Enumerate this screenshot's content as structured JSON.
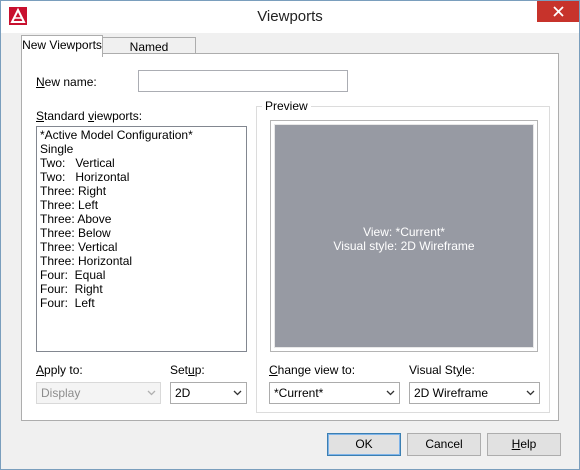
{
  "window": {
    "title": "Viewports"
  },
  "tabs": [
    {
      "label": "New Viewports",
      "active": true
    },
    {
      "label": "Named Viewports",
      "active": false
    }
  ],
  "new_name": {
    "label_first": "N",
    "label_rest": "ew name:",
    "value": ""
  },
  "standard_viewports": {
    "label_first": "S",
    "label_mid": "tandard ",
    "label_u": "v",
    "label_rest": "iewports:",
    "items": [
      "*Active Model Configuration*",
      "Single",
      "Two:   Vertical",
      "Two:   Horizontal",
      "Three: Right",
      "Three: Left",
      "Three: Above",
      "Three: Below",
      "Three: Vertical",
      "Three: Horizontal",
      "Four:  Equal",
      "Four:  Right",
      "Four:  Left"
    ],
    "selected_index": 0
  },
  "preview": {
    "label": "Preview",
    "line1": "View: *Current*",
    "line2": "Visual style: 2D Wireframe",
    "color": "#979aa3"
  },
  "apply_to": {
    "label_first": "A",
    "label_rest": "pply to:",
    "value": "Display",
    "disabled": true
  },
  "setup": {
    "label_first": "Set",
    "label_u": "u",
    "label_rest": "p:",
    "value": "2D"
  },
  "change_view": {
    "label_first": "C",
    "label_rest": "hange view to:",
    "value": "*Current*"
  },
  "visual_style": {
    "label_first": "Visual St",
    "label_u": "y",
    "label_rest": "le:",
    "value": "2D Wireframe"
  },
  "buttons": {
    "ok": "OK",
    "cancel": "Cancel",
    "help_first": "H",
    "help_rest": "elp"
  },
  "colors": {
    "close_button": "#c7332b",
    "selection": "#3399ff",
    "app_icon": "#c8102e"
  }
}
